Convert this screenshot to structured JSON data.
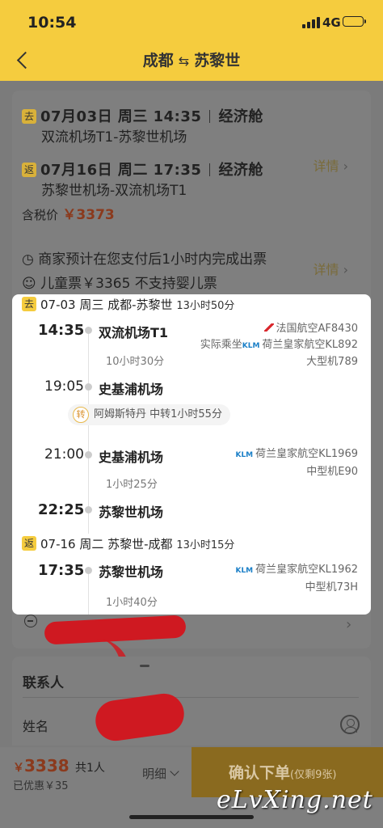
{
  "status_bar": {
    "time": "10:54",
    "network": "4G"
  },
  "nav": {
    "from": "成都",
    "swap": "⇆",
    "to": "苏黎世"
  },
  "summary": {
    "outbound": {
      "tag": "去",
      "datetime": "07月03日 周三 14:35",
      "cabin": "经济舱",
      "route": "双流机场T1-苏黎世机场"
    },
    "return": {
      "tag": "返",
      "datetime": "07月16日 周二 17:35",
      "cabin": "经济舱",
      "route": "苏黎世机场-双流机场T1"
    },
    "detail_label": "详情",
    "tax_label": "含税价",
    "tax_price": "￥3373",
    "notice": "商家预计在您支付后1小时内完成出票",
    "child_ticket": "儿童票￥3365  不支持婴儿票",
    "detail_label2": "详情"
  },
  "timeline": {
    "outbound": {
      "tag": "去",
      "header": "07-03 周三 成都-苏黎世",
      "duration": "13小时50分",
      "seg1": {
        "dep_time": "14:35",
        "dep_airport": "双流机场T1",
        "airline": "法国航空AF8430",
        "operated": "实际乘坐",
        "operated_airline": "荷兰皇家航空KL892",
        "aircraft": "大型机789",
        "flight_duration": "10小时30分",
        "arr_time": "19:05",
        "arr_airport": "史基浦机场"
      },
      "transfer": {
        "icon": "转",
        "text": "阿姆斯特丹 中转1小时55分"
      },
      "seg2": {
        "dep_time": "21:00",
        "dep_airport": "史基浦机场",
        "airline": "荷兰皇家航空KL1969",
        "aircraft": "中型机E90",
        "flight_duration": "1小时25分",
        "arr_time": "22:25",
        "arr_airport": "苏黎世机场"
      }
    },
    "return": {
      "tag": "返",
      "header": "07-16 周二 苏黎世-成都",
      "duration": "13小时15分",
      "seg1": {
        "dep_time": "17:35",
        "dep_airport": "苏黎世机场",
        "airline": "荷兰皇家航空KL1962",
        "aircraft": "中型机73H",
        "flight_duration": "1小时40分"
      }
    },
    "klm_logo": "KLM"
  },
  "contact": {
    "title": "联系人",
    "name_label": "姓名"
  },
  "bottom": {
    "currency": "￥",
    "price": "3338",
    "count": "共1人",
    "saved": "已优惠￥35",
    "detail_toggle": "明细",
    "confirm": "确认下单",
    "confirm_sub": "(仅剩9张)"
  },
  "watermark": "eLvXing.net",
  "colors": {
    "header": "#f5cc3e",
    "price": "#8b3a1d",
    "confirm_button": "#8a6a1f"
  }
}
